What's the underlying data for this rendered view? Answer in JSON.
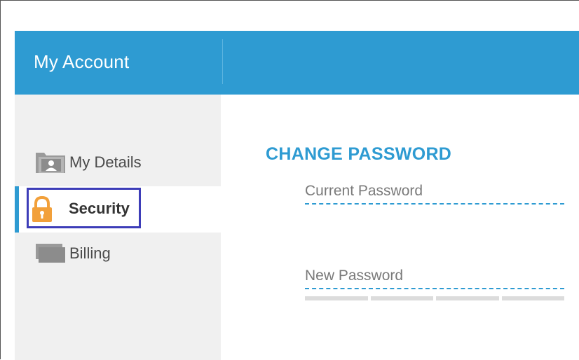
{
  "header": {
    "title": "My Account"
  },
  "sidebar": {
    "items": [
      {
        "label": "My Details",
        "icon": "person-folder-icon",
        "active": false
      },
      {
        "label": "Security",
        "icon": "lock-icon",
        "active": true
      },
      {
        "label": "Billing",
        "icon": "card-folder-icon",
        "active": false
      }
    ]
  },
  "main": {
    "section_title": "CHANGE PASSWORD",
    "fields": [
      {
        "label": "Current Password",
        "value": ""
      },
      {
        "label": "New Password",
        "value": ""
      }
    ],
    "strength_meter": {
      "segments": 4,
      "filled": 0
    }
  },
  "colors": {
    "accent": "#2e9bd2",
    "sidebar_bg": "#f0f0f0",
    "highlight": "#3d3db8",
    "lock": "#f2a03a"
  }
}
